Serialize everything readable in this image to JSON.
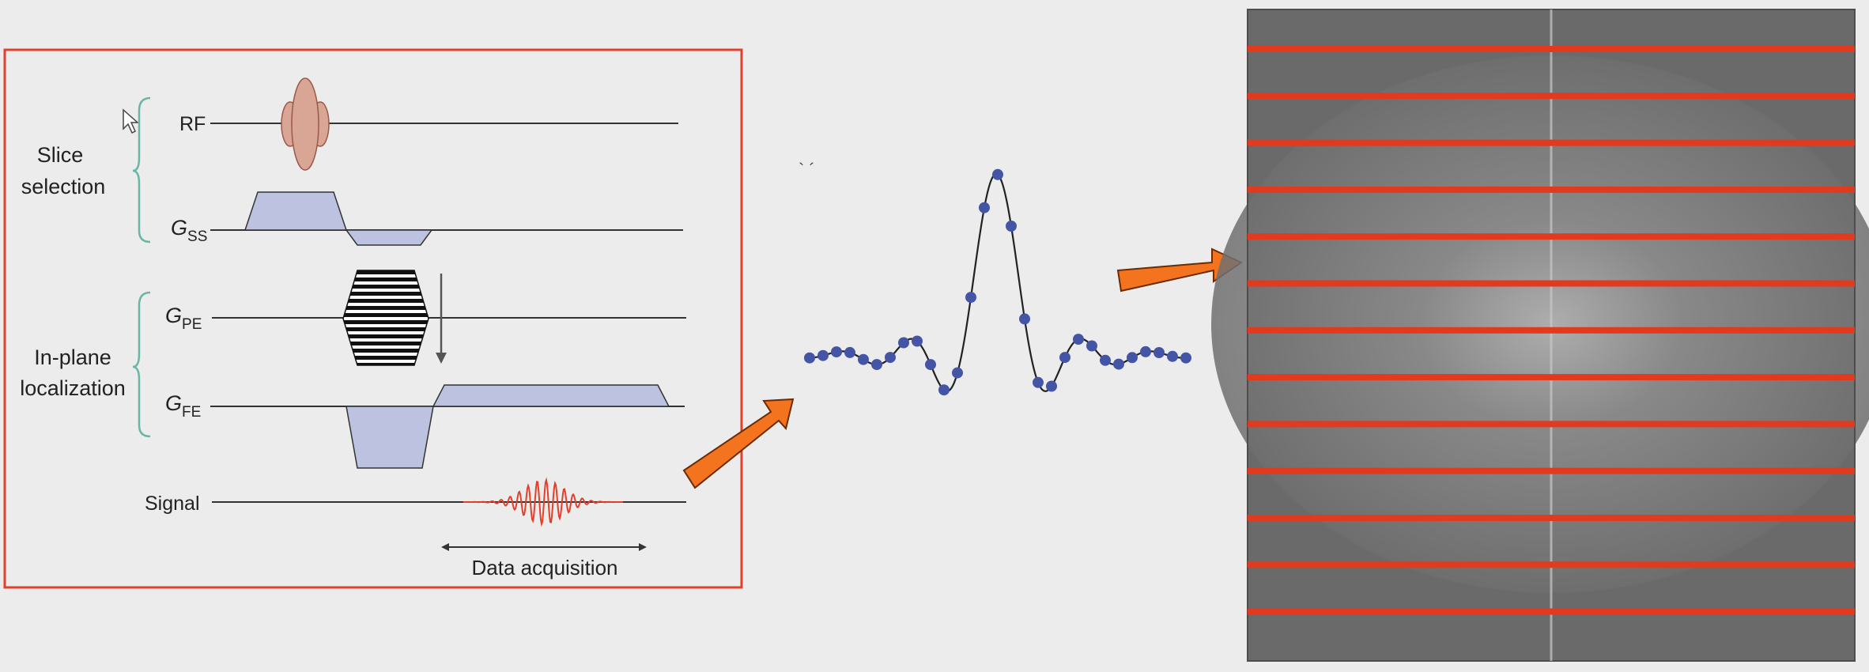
{
  "diagram": {
    "labels": {
      "rf": "RF",
      "gss_main": "G",
      "gss_sub": "SS",
      "gpe_main": "G",
      "gpe_sub": "PE",
      "gfe_main": "G",
      "gfe_sub": "FE",
      "signal": "Signal",
      "slice_selection_line1": "Slice",
      "slice_selection_line2": "selection",
      "inplane_line1": "In-plane",
      "inplane_line2": "localization",
      "data_acquisition": "Data acquisition"
    },
    "kspace": {
      "line_count": 13
    },
    "colors": {
      "frame": "#e2402b",
      "arrow": "#f4731f",
      "rf_pulse": "#d9a595",
      "gradient_fill": "#bcc2df",
      "signal": "#e2402b",
      "brace": "#6ab5a3",
      "samples": "#4455a6",
      "kspace_lines": "#e03a1f"
    }
  }
}
